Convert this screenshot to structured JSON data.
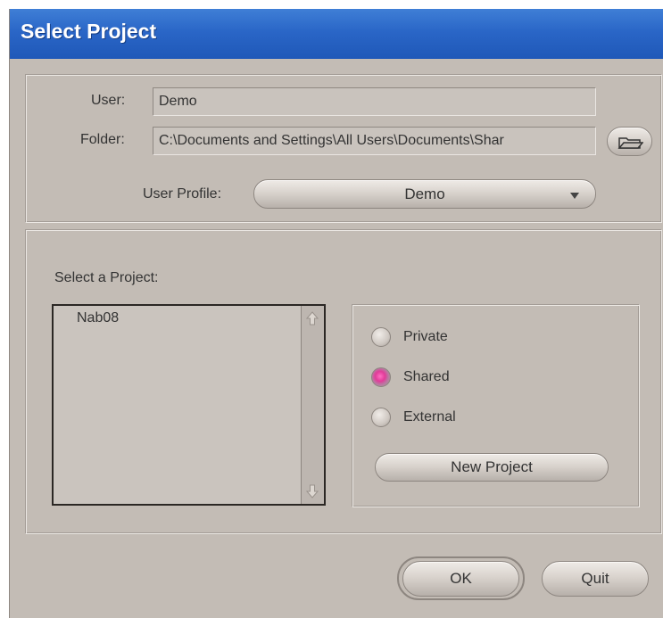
{
  "window": {
    "title": "Select Project"
  },
  "user_section": {
    "user_label": "User:",
    "user_value": "Demo",
    "folder_label": "Folder:",
    "folder_value": "C:\\Documents and Settings\\All Users\\Documents\\Shar",
    "profile_label": "User Profile:",
    "profile_value": "Demo"
  },
  "project_section": {
    "select_label": "Select a Project:",
    "projects": [
      "Nab08"
    ],
    "types": [
      {
        "label": "Private",
        "selected": false
      },
      {
        "label": "Shared",
        "selected": true
      },
      {
        "label": "External",
        "selected": false
      }
    ],
    "new_project_label": "New Project"
  },
  "buttons": {
    "ok": "OK",
    "quit": "Quit"
  },
  "colors": {
    "titlebar": "#2a66c7",
    "window_bg": "#c3bcb5",
    "radio_selected": "#e23b99"
  },
  "icons": {
    "folder_browse": "folder-open-icon",
    "scroll_up": "arrow-up-icon",
    "scroll_down": "arrow-down-icon",
    "dropdown": "triangle-down-icon"
  }
}
